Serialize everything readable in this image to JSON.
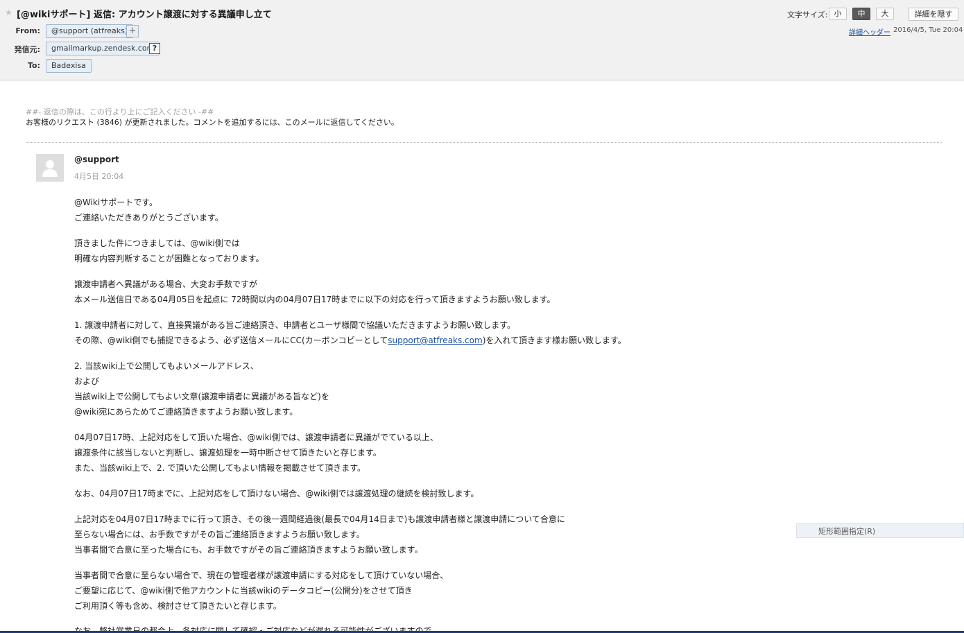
{
  "header": {
    "star_glyph": "★",
    "subject": "[@wikiサポート] 返信: アカウント譲渡に対する異議申し立て",
    "from_label": "From:",
    "from_chip": "@support (atfreaks)",
    "add_glyph": "+",
    "sender_label": "発信元:",
    "sender_chip": "gmailmarkup.zendesk.com",
    "help_glyph": "?",
    "to_label": "To:",
    "to_chip": "Badexisa",
    "font_size_label": "文字サイズ:",
    "font_small": "小",
    "font_medium": "中",
    "font_large": "大",
    "hide_details": "詳細を隠す",
    "detail_header_link": "詳細ヘッダー",
    "datetime": "2016/4/5, Tue 20:04"
  },
  "message": {
    "preamble_hint": "##- 返信の際は、この行より上にご記入ください -##",
    "preamble_notice": "お客様のリクエスト (3846) が更新されました。コメントを追加するには、このメールに返信してください。",
    "author": "@support",
    "date": "4月5日 20:04",
    "paragraphs": {
      "p1": {
        "l1": "@Wikiサポートです。",
        "l2": "ご連絡いただきありがとうございます。"
      },
      "p2": {
        "l1": "頂きました件につきましては、@wiki側では",
        "l2": "明確な内容判断することが困難となっております。"
      },
      "p3": {
        "l1": "譲渡申請者へ異議がある場合、大変お手数ですが",
        "l2": "本メール送信日である04月05日を起点に 72時間以内の04月07日17時までに以下の対応を行って頂きますようお願い致します。"
      },
      "p4": {
        "l1": "1. 譲渡申請者に対して、直接異議がある旨ご連絡頂き、申請者とユーザ様間で協議いただきますようお願い致します。",
        "l2_pre": "その際、@wiki側でも捕捉できるよう、必ず送信メールにCC(カーボンコピーとして",
        "l2_link": "support@atfreaks.com",
        "l2_post": ")を入れて頂きます様お願い致します。"
      },
      "p5": {
        "l1": "2. 当該wiki上で公開してもよいメールアドレス、",
        "l2": "および",
        "l3": "当該wiki上で公開してもよい文章(譲渡申請者に異議がある旨など)を",
        "l4": "@wiki宛にあらためてご連絡頂きますようお願い致します。"
      },
      "p6": {
        "l1": "04月07日17時、上記対応をして頂いた場合、@wiki側では、譲渡申請者に異議がでている以上、",
        "l2": "譲渡条件に該当しないと判断し、譲渡処理を一時中断させて頂きたいと存じます。",
        "l3": "また、当該wiki上で、2. で頂いた公開してもよい情報を掲載させて頂きます。"
      },
      "p7": {
        "l1": "なお、04月07日17時までに、上記対応をして頂けない場合、@wiki側では譲渡処理の継続を検討致します。"
      },
      "p8": {
        "l1": "上記対応を04月07日17時までに行って頂き、その後一週間経過後(最長で04月14日まで)も譲渡申請者様と譲渡申請について合意に",
        "l2": "至らない場合には、お手数ですがその旨ご連絡頂きますようお願い致します。",
        "l3": "当事者間で合意に至った場合にも、お手数ですがその旨ご連絡頂きますようお願い致します。"
      },
      "p9": {
        "l1": "当事者間で合意に至らない場合で、現在の管理者様が譲渡申請にする対応をして頂けていない場合、",
        "l2": "ご要望に応じて、@wiki側で他アカウントに当該wikiのデータコピー(公開分)をさせて頂き",
        "l3": "ご利用頂く等も含め、検討させて頂きたいと存じます。"
      },
      "cutoff": "なお、弊社営業日の都合上、各対応に関して確認・ご対応などが遅れる可能性がございますので"
    }
  },
  "context_menu": {
    "item_label": "矩形範囲指定(R)"
  },
  "colors": {
    "header_bg": "#f1f1f1",
    "chip_bg": "#e6eef7",
    "link": "#1a4f9c",
    "bottom_bar": "#1d3f75"
  }
}
